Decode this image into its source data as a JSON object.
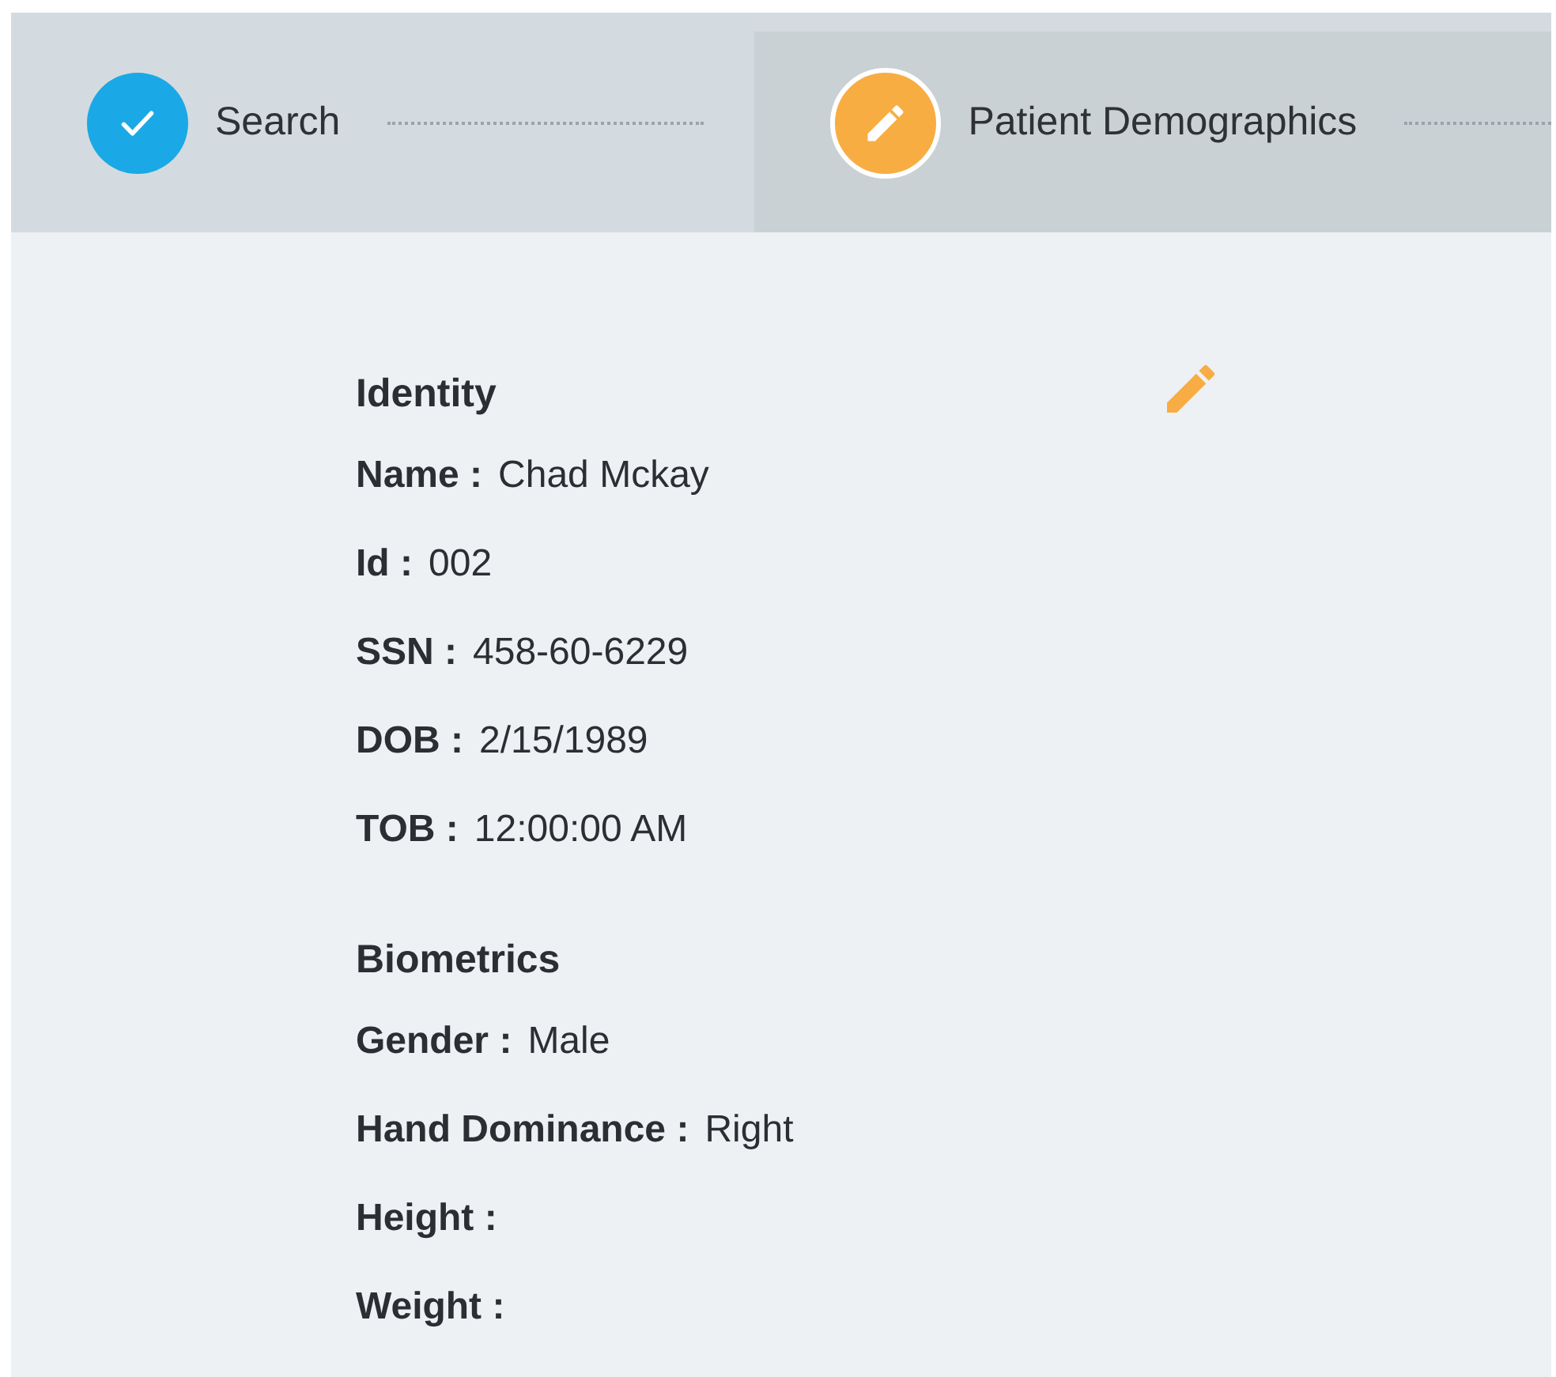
{
  "stepper": [
    {
      "label": "Search",
      "kind": "done",
      "selected": false
    },
    {
      "label": "Patient Demographics",
      "kind": "active",
      "selected": true
    }
  ],
  "sections": [
    {
      "title": "Identity",
      "editable": true,
      "fields": [
        {
          "label": "Name :",
          "value": "Chad Mckay"
        },
        {
          "label": "Id :",
          "value": "002"
        },
        {
          "label": "SSN :",
          "value": "458-60-6229"
        },
        {
          "label": "DOB :",
          "value": "2/15/1989"
        },
        {
          "label": "TOB :",
          "value": "12:00:00 AM"
        }
      ]
    },
    {
      "title": "Biometrics",
      "editable": false,
      "fields": [
        {
          "label": "Gender :",
          "value": "Male"
        },
        {
          "label": "Hand Dominance :",
          "value": "Right"
        },
        {
          "label": "Height :"
        },
        {
          "label": "Weight :"
        }
      ]
    }
  ]
}
